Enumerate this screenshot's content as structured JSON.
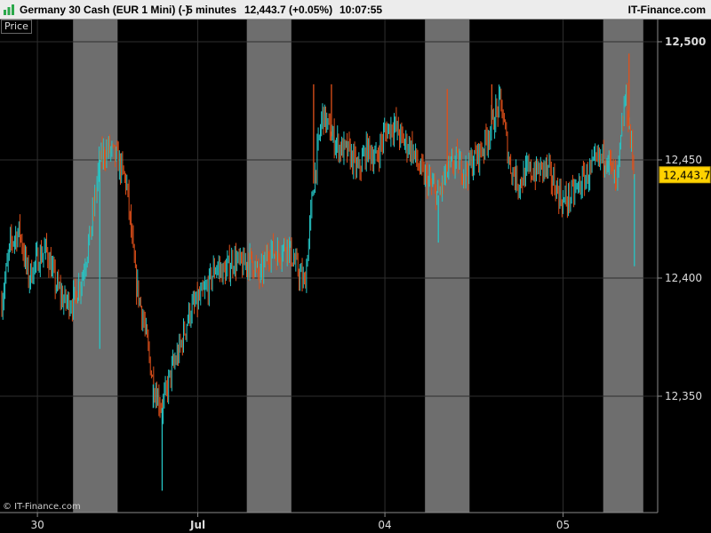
{
  "header": {
    "title": "Germany 30 Cash (EUR 1 Mini) (-)",
    "interval": "5 minutes",
    "price_change": "12,443.7 (+0.05%)",
    "time": "10:07:55",
    "brand": "IT-Finance.com"
  },
  "panel_label": "Price",
  "credit": "© IT-Finance.com",
  "colors": {
    "background": "#000000",
    "up": "#26c6c6",
    "down": "#e0501a",
    "session_shade": "#6e6e6e",
    "grid": "#2e2e2e",
    "current_price_bg": "#ffd200"
  },
  "chart_data": {
    "type": "candlestick",
    "x_labels": [
      {
        "label": "30",
        "slot": 2
      },
      {
        "label": "Jul",
        "slot": 11
      },
      {
        "label": "04",
        "slot": 21.5
      },
      {
        "label": "05",
        "slot": 31.5
      }
    ],
    "shaded_slots": [
      [
        4,
        6.5
      ],
      [
        13.75,
        16.25
      ],
      [
        23.75,
        26.25
      ],
      [
        33.75,
        36
      ]
    ],
    "slot_count": 37,
    "y_ticks": [
      {
        "value": 12500,
        "label": "12,500"
      },
      {
        "value": 12450,
        "label": "12,450"
      },
      {
        "value": 12400,
        "label": "12,400"
      },
      {
        "value": 12350,
        "label": "12,350"
      }
    ],
    "ylim": [
      12302,
      12513
    ],
    "last_price": {
      "value": 12443.7,
      "label": "12,443.7"
    },
    "path": [
      [
        0,
        12390
      ],
      [
        0.5,
        12415
      ],
      [
        1,
        12420
      ],
      [
        1.5,
        12400
      ],
      [
        2,
        12408
      ],
      [
        2.5,
        12412
      ],
      [
        3,
        12398
      ],
      [
        3.5,
        12390
      ],
      [
        4,
        12390
      ],
      [
        4.5,
        12400
      ],
      [
        5,
        12420
      ],
      [
        5.5,
        12450
      ],
      [
        6,
        12455
      ],
      [
        6.5,
        12450
      ],
      [
        7,
        12440
      ],
      [
        7.5,
        12400
      ],
      [
        8,
        12380
      ],
      [
        8.5,
        12355
      ],
      [
        9,
        12345
      ],
      [
        9.5,
        12360
      ],
      [
        10,
        12370
      ],
      [
        10.5,
        12385
      ],
      [
        11,
        12390
      ],
      [
        11.5,
        12395
      ],
      [
        12,
        12405
      ],
      [
        12.5,
        12402
      ],
      [
        13,
        12408
      ],
      [
        13.5,
        12405
      ],
      [
        14,
        12408
      ],
      [
        14.5,
        12400
      ],
      [
        15,
        12412
      ],
      [
        15.5,
        12410
      ],
      [
        16,
        12415
      ],
      [
        16.5,
        12405
      ],
      [
        17,
        12397
      ],
      [
        17.5,
        12440
      ],
      [
        18,
        12470
      ],
      [
        18.5,
        12460
      ],
      [
        19,
        12455
      ],
      [
        19.5,
        12453
      ],
      [
        20,
        12445
      ],
      [
        20.5,
        12455
      ],
      [
        21,
        12450
      ],
      [
        21.5,
        12462
      ],
      [
        22,
        12465
      ],
      [
        22.5,
        12458
      ],
      [
        23,
        12455
      ],
      [
        23.5,
        12445
      ],
      [
        24,
        12440
      ],
      [
        24.5,
        12435
      ],
      [
        25,
        12445
      ],
      [
        25.5,
        12450
      ],
      [
        26,
        12445
      ],
      [
        26.5,
        12450
      ],
      [
        27,
        12455
      ],
      [
        27.5,
        12465
      ],
      [
        28,
        12475
      ],
      [
        28.5,
        12448
      ],
      [
        29,
        12440
      ],
      [
        29.5,
        12445
      ],
      [
        30,
        12445
      ],
      [
        30.5,
        12447
      ],
      [
        31,
        12440
      ],
      [
        31.5,
        12432
      ],
      [
        32,
        12435
      ],
      [
        32.5,
        12440
      ],
      [
        33,
        12445
      ],
      [
        33.5,
        12450
      ],
      [
        34,
        12452
      ],
      [
        34.5,
        12438
      ],
      [
        35,
        12478
      ],
      [
        35.5,
        12444
      ]
    ],
    "spikes": [
      [
        9,
        12310
      ],
      [
        5.5,
        12370
      ],
      [
        17.5,
        12482
      ],
      [
        18.5,
        12482
      ],
      [
        25,
        12480
      ],
      [
        27.5,
        12482
      ],
      [
        35.5,
        12405
      ],
      [
        35.2,
        12495
      ],
      [
        8.5,
        12345
      ],
      [
        24.5,
        12415
      ]
    ]
  }
}
